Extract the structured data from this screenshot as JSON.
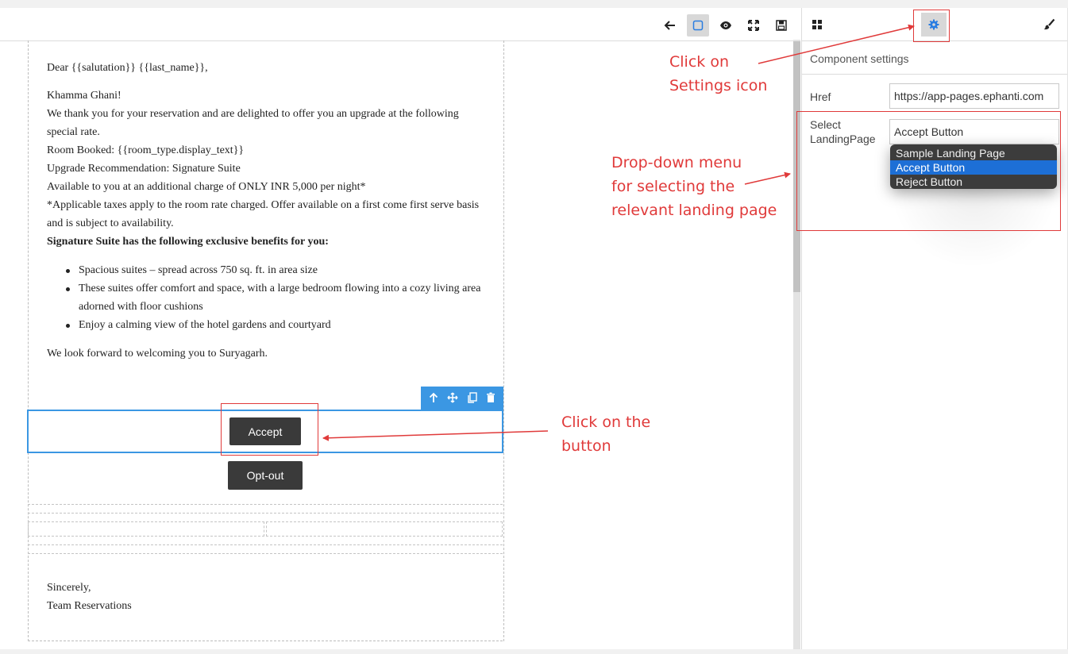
{
  "toolbar": {
    "icons": [
      "arrow-left-icon",
      "square-outline-icon",
      "eye-icon",
      "fullscreen-icon",
      "save-icon"
    ]
  },
  "panel": {
    "tabs": [
      "blocks-grid-icon",
      "gear-icon",
      "paintbrush-icon"
    ],
    "title": "Component settings",
    "href_label": "Href",
    "href_value": "https://app-pages.ephanti.com",
    "select_label": "Select LandingPage",
    "select_value": "Accept Button",
    "options": [
      "Sample Landing Page",
      "Accept Button",
      "Reject Button"
    ],
    "selected_option": "Accept Button"
  },
  "email": {
    "greeting": "Dear {{salutation}} {{last_name}},",
    "salute": "Khamma Ghani!",
    "lines": [
      "We thank you for your reservation and are delighted to offer you an upgrade at the following",
      "special rate.",
      "Room Booked: {{room_type.display_text}}",
      "Upgrade Recommendation: Signature Suite",
      "Available to you at an additional charge of ONLY INR 5,000 per night*",
      "*Applicable taxes apply to the room rate charged. Offer available on a first come first serve basis",
      "and is subject to availability."
    ],
    "benefits_heading": "Signature Suite has the following exclusive benefits for you:",
    "bullets": [
      "Spacious suites – spread across 750 sq. ft. in area size",
      "These suites offer comfort and space, with a large bedroom flowing into a cozy living area",
      "adorned with floor cushions",
      "Enjoy a calming view of the hotel gardens and courtyard"
    ],
    "closing": "We look forward to welcoming you to Suryagarh.",
    "accept_label": "Accept",
    "optout_label": "Opt-out",
    "signoff": "Sincerely,",
    "team": "Team Reservations"
  },
  "selection_toolbar": {
    "icons": [
      "arrow-up-icon",
      "move-icon",
      "copy-icon",
      "trash-icon"
    ]
  },
  "annotations": {
    "settings": [
      "Click on",
      "Settings icon"
    ],
    "dropdown": [
      "Drop-down menu",
      "for selecting the",
      "relevant landing page"
    ],
    "button": [
      "Click on the",
      "button"
    ],
    "color": "#e03a3a"
  }
}
